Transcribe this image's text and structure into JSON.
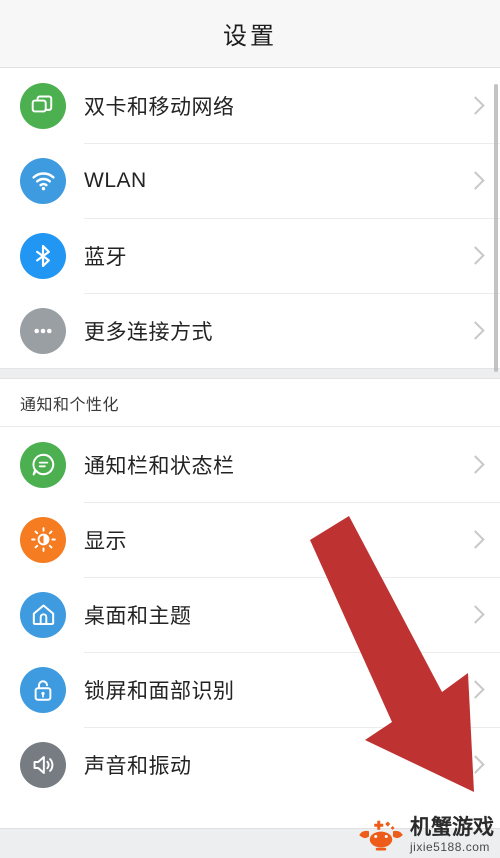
{
  "header": {
    "title": "设置"
  },
  "sections": [
    {
      "id": "connections",
      "title": "",
      "items": [
        {
          "label": "双卡和移动网络",
          "icon": "sim-cards-icon",
          "color": "#4CAF50"
        },
        {
          "label": "WLAN",
          "icon": "wifi-icon",
          "color": "#3E9BE0"
        },
        {
          "label": "蓝牙",
          "icon": "bluetooth-icon",
          "color": "#2196F3"
        },
        {
          "label": "更多连接方式",
          "icon": "more-dots-icon",
          "color": "#9A9FA3"
        }
      ]
    },
    {
      "id": "notifications-personalization",
      "title": "通知和个性化",
      "items": [
        {
          "label": "通知栏和状态栏",
          "icon": "chat-bubble-icon",
          "color": "#4CAF50"
        },
        {
          "label": "显示",
          "icon": "brightness-icon",
          "color": "#F57C20"
        },
        {
          "label": "桌面和主题",
          "icon": "home-icon",
          "color": "#3E9BE0"
        },
        {
          "label": "锁屏和面部识别",
          "icon": "lock-icon",
          "color": "#3E9BE0"
        },
        {
          "label": "声音和振动",
          "icon": "speaker-icon",
          "color": "#767C82"
        }
      ]
    }
  ],
  "annotation": {
    "arrow": {
      "name": "red-arrow-annotation",
      "color": "#BE3232"
    }
  },
  "watermark": {
    "name": "机蟹游戏",
    "url": "jixie5188.com",
    "logo_color": "#EE5C1A"
  },
  "chevron_icon": "chevron-right-icon",
  "scrollbar": "vertical-scrollbar"
}
